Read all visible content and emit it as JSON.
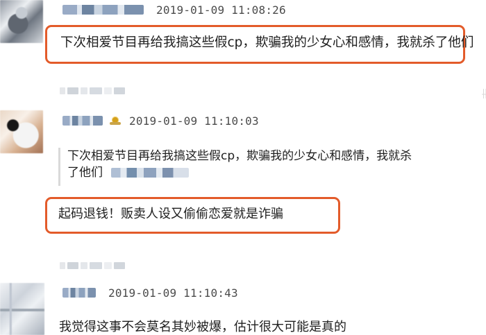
{
  "comments": [
    {
      "timestamp": "2019-01-09 11:08:26",
      "text": "下次相爱节目再给我搞这些假cp，欺骗我的少女心和感情，我就杀了他们"
    },
    {
      "timestamp": "2019-01-09 11:10:03",
      "quote_line_1": "下次相爱节目再给我搞这些假cp，欺骗我的少女心和感情，我就杀",
      "quote_line_2": "了他们",
      "text": "起码退钱！贩卖人设又偷偷恋爱就是诈骗"
    },
    {
      "timestamp": "2019-01-09 11:10:43",
      "text": "我觉得这事不会莫名其妙被爆，估计很大可能是真的"
    }
  ],
  "colors": {
    "highlight_border": "#e35b2a",
    "timestamp_text": "#4b4b4b",
    "body_text": "#202020",
    "quote_border": "#d9d9d9"
  }
}
